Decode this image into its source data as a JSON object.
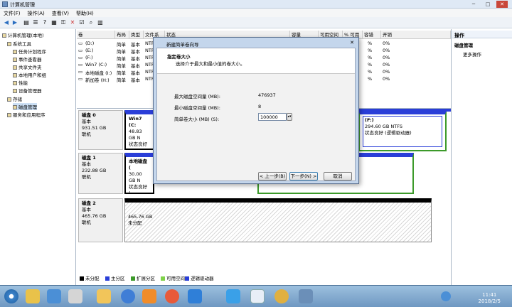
{
  "window": {
    "title": "计算机管理"
  },
  "menu": [
    "文件(F)",
    "操作(A)",
    "查看(V)",
    "帮助(H)"
  ],
  "tree": [
    {
      "label": "计算机管理(本地)",
      "depth": 0
    },
    {
      "label": "系统工具",
      "depth": 1
    },
    {
      "label": "任务计划程序",
      "depth": 2
    },
    {
      "label": "事件查看器",
      "depth": 2
    },
    {
      "label": "共享文件夹",
      "depth": 2
    },
    {
      "label": "本地用户和组",
      "depth": 2
    },
    {
      "label": "性能",
      "depth": 2
    },
    {
      "label": "设备管理器",
      "depth": 2
    },
    {
      "label": "存储",
      "depth": 1
    },
    {
      "label": "磁盘管理",
      "depth": 2
    },
    {
      "label": "服务和应用程序",
      "depth": 1
    }
  ],
  "volumes": {
    "headers": [
      "卷",
      "布局",
      "类型",
      "文件系",
      "状态",
      "容量",
      "可用空间",
      "% 可用",
      "容错",
      "开销"
    ],
    "rows": [
      {
        "name": "(D:)",
        "layout": "简单",
        "type": "基本",
        "fs": "NTF",
        "pct": "%",
        "cost": "0%"
      },
      {
        "name": "(E:)",
        "layout": "简单",
        "type": "基本",
        "fs": "NTF",
        "pct": "%",
        "cost": "0%"
      },
      {
        "name": "(F:)",
        "layout": "简单",
        "type": "基本",
        "fs": "NTF",
        "pct": "%",
        "cost": "0%"
      },
      {
        "name": "Win7 (C:)",
        "layout": "简单",
        "type": "基本",
        "fs": "NTF",
        "pct": "%",
        "cost": "0%"
      },
      {
        "name": "本地磁盘 (I:)",
        "layout": "简单",
        "type": "基本",
        "fs": "NTF",
        "pct": "%",
        "cost": "0%"
      },
      {
        "name": "新加卷 (H:)",
        "layout": "简单",
        "type": "基本",
        "fs": "NTF",
        "pct": "%",
        "cost": "0%"
      }
    ]
  },
  "disks": [
    {
      "name": "磁盘 0",
      "type": "基本",
      "size": "931.51 GB",
      "status": "联机",
      "p1": {
        "title": "Win7 (C:",
        "size": "48.83 GB N",
        "state": "状态良好 ("
      },
      "p2": {
        "title": "(F:)",
        "size": "294.60 GB NTFS",
        "state": "状态良好 (逻辑驱动器)"
      }
    },
    {
      "name": "磁盘 1",
      "type": "基本",
      "size": "232.88 GB",
      "status": "联机",
      "p1": {
        "title": "本地磁盘 (",
        "size": "30.00 GB N",
        "state": "状态良好 ("
      }
    },
    {
      "name": "磁盘 2",
      "type": "基本",
      "size": "465.76 GB",
      "status": "联机",
      "p1": {
        "size": "465.76 GB",
        "state": "未分配"
      }
    }
  ],
  "legend": [
    "未分配",
    "主分区",
    "扩展分区",
    "可用空间",
    "逻辑驱动器"
  ],
  "legend_colors": [
    "#000000",
    "#2a3ed8",
    "#3c9a2a",
    "#7fd24a",
    "#2a3ed8"
  ],
  "actions": {
    "header": "操作",
    "sub": "磁盘管理",
    "more": "更多操作"
  },
  "dialog": {
    "title": "新建简单卷向导",
    "heading": "指定卷大小",
    "subheading": "选择介于最大和最小值的卷大小。",
    "max_label": "最大磁盘空间量 (MB):",
    "max_value": "476937",
    "min_label": "最小磁盘空间量 (MB):",
    "min_value": "8",
    "size_label": "简单卷大小 (MB) (S):",
    "size_value": "100000",
    "back": "< 上一步(B)",
    "next": "下一步(N) >",
    "cancel": "取消"
  },
  "clock": {
    "time": "11:41",
    "date": "2018/2/5"
  }
}
